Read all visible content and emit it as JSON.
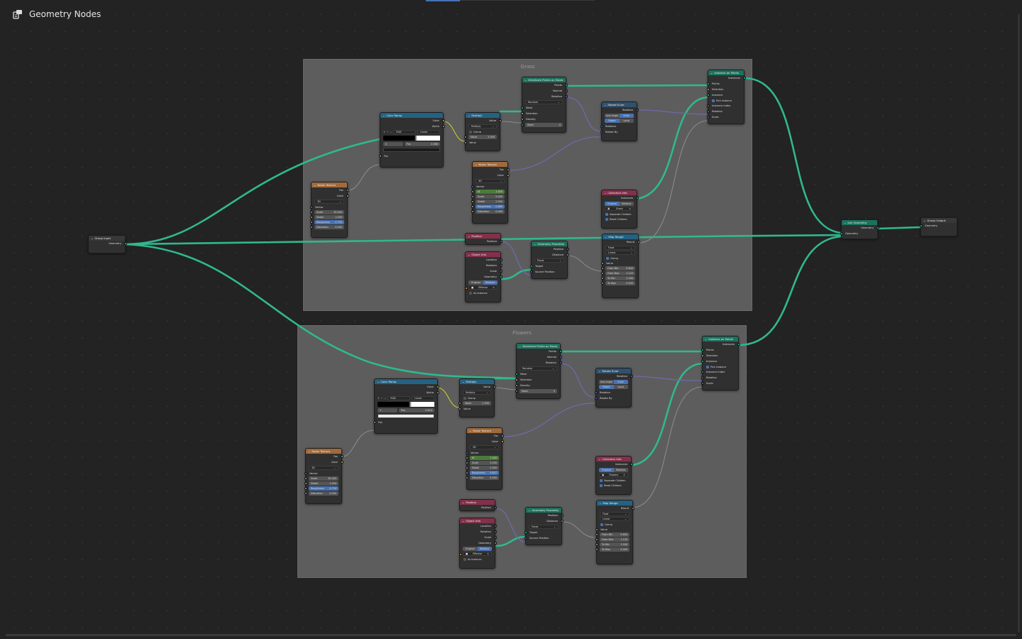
{
  "editor": {
    "title": "Geometry Nodes",
    "icon": "node-tree-icon"
  },
  "frames": {
    "grass": "Grass",
    "flowers": "Flowers"
  },
  "nodes": {
    "group_input": {
      "title": "Group Input",
      "geometry": "Geometry"
    },
    "group_output": {
      "title": "Group Output",
      "geometry": "Geometry"
    },
    "join": {
      "title": "Join Geometry",
      "geometry": "Geometry"
    },
    "dist": {
      "title": "Distribute Points on Faces",
      "points": "Points",
      "normal": "Normal",
      "rotation": "Rotation",
      "mode": "Random",
      "mesh": "Mesh",
      "selection": "Selection",
      "density": "Density",
      "seed": "Seed",
      "seed_val": "0"
    },
    "colorramp": {
      "title": "Color Ramp",
      "color": "Color",
      "alpha": "Alpha",
      "mode": "RGB",
      "interp": "Linear",
      "stop": "0",
      "pos": "Pos",
      "pos_val": "0.586",
      "fac": "Fac"
    },
    "colorramp_f": {
      "pos_val": "0.610",
      "stop": "1",
      "interp": "Linear"
    },
    "multiply": {
      "title": "Multiply",
      "value": "Value",
      "op": "Multiply",
      "clamp": "Clamp",
      "val_label": "Value",
      "val": "2.000",
      "val_f": "1.300"
    },
    "noise1": {
      "title": "Noise Texture",
      "fac": "Fac",
      "color": "Color",
      "dim": "3D",
      "vector": "Vector",
      "scale": "Scale",
      "scale_val": "30.000",
      "detail": "Detail",
      "detail_val": "1.000",
      "rough": "Roughness",
      "rough_val": "0.750",
      "distort": "Distortion",
      "distort_val": "0.000"
    },
    "noise2": {
      "title": "Noise Texture",
      "fac": "Fac",
      "color": "Color",
      "dim": "3D",
      "vector": "Vector",
      "w": "W",
      "w_val": "1.440",
      "scale": "Scale",
      "scale_val": "5.000",
      "detail": "Detail",
      "detail_val": "2.000",
      "rough": "Roughness",
      "rough_val": "0.660",
      "distort": "Distortion",
      "distort_val": "0.000",
      "w_val_f": "1.000",
      "scale_val_f": "3.200",
      "rough_val_f": "0.657"
    },
    "rotate": {
      "title": "Rotate Euler",
      "rotation": "Rotation",
      "axis": "Axis Angle",
      "euler": "Euler",
      "object": "Object",
      "local": "Local",
      "rot_in": "Rotation",
      "rotate_by": "Rotate By"
    },
    "instance": {
      "title": "Instance on Points",
      "instances": "Instances",
      "points": "Points",
      "selection": "Selection",
      "instance": "Instance",
      "pick": "Pick Instance",
      "index": "Instance Index",
      "rotation": "Rotation",
      "scale": "Scale"
    },
    "collection": {
      "title": "Collection Info",
      "instances": "Instances",
      "original": "Original",
      "relative": "Relative",
      "coll": "Grass",
      "coll_f": "Flowers",
      "separate": "Separate Children",
      "reset": "Reset Children"
    },
    "position": {
      "title": "Position",
      "position": "Position"
    },
    "objinfo": {
      "title": "Object Info",
      "location": "Location",
      "rotation": "Rotation",
      "scale": "Scale",
      "geometry": "Geometry",
      "original": "Original",
      "relative": "Relative",
      "obj": "Effector",
      "as_inst": "As Instance"
    },
    "proximity": {
      "title": "Geometry Proximity",
      "position": "Position",
      "distance": "Distance",
      "mode": "Faces",
      "target": "Target",
      "source": "Source Position"
    },
    "maprange": {
      "title": "Map Range",
      "result": "Result",
      "type": "Float",
      "interp": "Linear",
      "clamp": "Clamp",
      "value": "Value",
      "fmin": "From Min",
      "fmin_val": "0.600",
      "fmax": "From Max",
      "fmax_val": "1.120",
      "tmin": "To Min",
      "tmin_val": "2.160",
      "tmax": "To Max",
      "tmax_val": "0.000",
      "fmin_val_f": "0.600",
      "fmax_val_f": "1.130",
      "tmin_val_f": "1.160"
    }
  },
  "colors": {
    "geometry_wire": "#30b88e",
    "float_wire": "#8a8a8a",
    "vector_wire": "#6d6aa8",
    "color_wire": "#c9c929"
  }
}
